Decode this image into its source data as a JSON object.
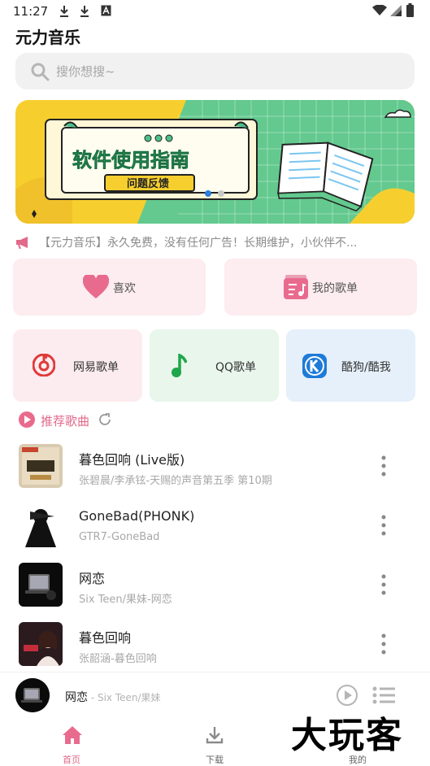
{
  "status_bar": {
    "time": "11:27"
  },
  "app": {
    "title": "元力音乐"
  },
  "search": {
    "placeholder": "搜你想搜~"
  },
  "banner": {
    "title": "软件使用指南",
    "subtitle": "问题反馈"
  },
  "notice": {
    "text": "【元力音乐】永久免费，没有任何广告！长期维护，小伙伴不..."
  },
  "quick_actions": [
    {
      "label": "喜欢",
      "icon": "heart-icon"
    },
    {
      "label": "我的歌单",
      "icon": "playlist-icon"
    }
  ],
  "sources": [
    {
      "label": "网易歌单",
      "icon": "netease-icon",
      "bg": "#fdecef"
    },
    {
      "label": "QQ歌单",
      "icon": "qq-music-icon",
      "bg": "#e8f6ec"
    },
    {
      "label": "酷狗/酷我",
      "icon": "kugou-icon",
      "bg": "#e6f0fb"
    }
  ],
  "recommend": {
    "label": "推荐歌曲"
  },
  "songs": [
    {
      "title": "暮色回响 (Live版)",
      "subtitle": "张碧晨/李承铉-天赐的声音第五季 第10期"
    },
    {
      "title": "GoneBad(PHONK)",
      "subtitle": "GTR7-GoneBad"
    },
    {
      "title": "网恋",
      "subtitle": "Six Teen/果妹-网恋"
    },
    {
      "title": "暮色回响",
      "subtitle": "张韶涵-暮色回响"
    }
  ],
  "player": {
    "title": "网恋",
    "subtitle": " - Six Teen/果妹"
  },
  "tabs": [
    {
      "label": "首页",
      "active": true
    },
    {
      "label": "下载",
      "active": false
    },
    {
      "label": "我的",
      "active": false
    }
  ],
  "watermark": {
    "text": "大玩客"
  },
  "colors": {
    "accent": "#e26a8a",
    "netease": "#e03a3a",
    "qq": "#1fa64a",
    "kugou": "#1e7bd8"
  }
}
